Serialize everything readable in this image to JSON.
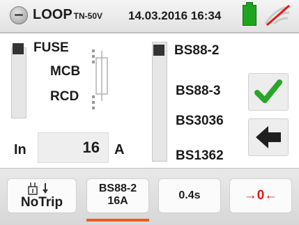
{
  "header": {
    "title": "LOOP",
    "title_sub": "TN-50V",
    "datetime": "14.03.2016 16:34",
    "icons": {
      "menu": "menu-icon",
      "battery": "battery-icon",
      "signal": "no-signal-icon"
    }
  },
  "protection_types": {
    "items": [
      "FUSE",
      "MCB",
      "RCD"
    ],
    "selected": "FUSE"
  },
  "characteristics": {
    "items": [
      "BS88-2",
      "BS88-3",
      "BS3036",
      "BS1362"
    ],
    "selected": "BS88-2"
  },
  "rated_current": {
    "label": "In",
    "value": "16",
    "unit": "A"
  },
  "actions": {
    "confirm_icon": "checkmark-icon",
    "back_icon": "back-arrow-icon"
  },
  "bottom_bar": {
    "notrip_label": "NoTrip",
    "fuse_line1": "BS88-2",
    "fuse_line2": "16A",
    "time_label": "0.4s",
    "zero_label": "→0←",
    "active_tab": "fuse"
  },
  "colors": {
    "check_green": "#2aa52a",
    "zero_red": "#e01a1a",
    "active_underline": "#f05a1e",
    "battery_green": "#1ea51e"
  }
}
